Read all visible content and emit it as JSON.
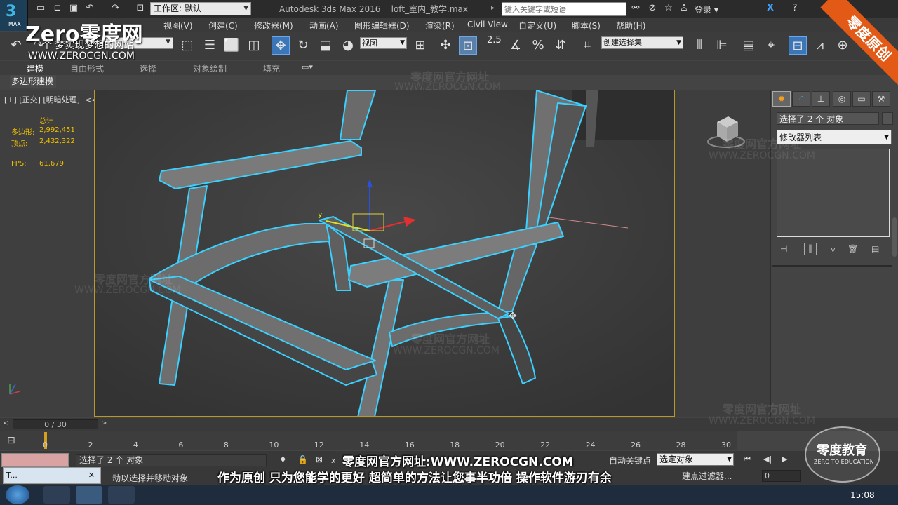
{
  "titlebar": {
    "workspace_label": "工作区: 默认",
    "app_title": "Autodesk 3ds Max 2016",
    "file_name": "loft_室内_教学.max",
    "search_placeholder": "键入关键字或短语",
    "login_label": "登录"
  },
  "menu": [
    {
      "label": "视图(V)"
    },
    {
      "label": "创建(C)"
    },
    {
      "label": "修改器(M)"
    },
    {
      "label": "动画(A)"
    },
    {
      "label": "图形编辑器(D)"
    },
    {
      "label": "渲染(R)"
    },
    {
      "label": "Civil View"
    },
    {
      "label": "自定义(U)"
    },
    {
      "label": "脚本(S)"
    },
    {
      "label": "帮助(H)"
    }
  ],
  "toolbar": {
    "view_dropdown": "视图",
    "selection_set": "创建选择集",
    "snap_value": "2.5"
  },
  "ribbon": {
    "tabs": [
      {
        "label": "建模"
      },
      {
        "label": "自由形式"
      },
      {
        "label": "选择"
      },
      {
        "label": "对象绘制"
      },
      {
        "label": "填充"
      }
    ],
    "sub_label": "多边形建模"
  },
  "viewport": {
    "label": "[+] [正交] [明暗处理]",
    "disabled_label": "<<已禁用>>",
    "stats": {
      "total_label": "总计",
      "poly_label": "多边形:",
      "poly_value": "2,992,451",
      "vert_label": "顶点:",
      "vert_value": "2,432,322",
      "fps_label": "FPS:",
      "fps_value": "61.679"
    },
    "gizmo_y_label": "y"
  },
  "command_panel": {
    "object_name": "选择了 2 个 对象",
    "modifier_list": "修改器列表"
  },
  "timeline": {
    "frame_label": "0 / 30",
    "ticks": [
      "0",
      "2",
      "4",
      "6",
      "8",
      "10",
      "12",
      "14",
      "16",
      "18",
      "20",
      "22",
      "24",
      "26",
      "28",
      "30"
    ]
  },
  "status": {
    "selection_msg": "选择了 2 个 对象",
    "prompt": "动以选择并移动对象",
    "autokey_label": "自动关键点",
    "selected_dropdown": "选定对象",
    "key_filter": "建点过滤器...",
    "frame_value": "0"
  },
  "watermarks": {
    "logo": "Zero零度网",
    "slogan": "个 梦实现梦想的网站",
    "url": "WWW.ZEROCGN.COM",
    "ghost_cn": "零度网官方网址",
    "ghost_url": "WWW.ZEROCGN.COM",
    "subtitle_line1": "零度网官方网址:WWW.ZEROCGN.COM",
    "subtitle_line2": "作为原创 只为您能学的更好 超简单的方法让您事半功倍 操作软件游刃有余",
    "corner_label": "零度原创",
    "corner_url": "WWW.ZEROCGN.COM",
    "edu_title": "零度教育",
    "edu_sub": "ZERO TO EDUCATION"
  },
  "taskbar": {
    "clock": "15:08",
    "task_label": "T..."
  },
  "colors": {
    "selection_highlight": "#3ad0ff",
    "viewport_border": "#b59a2a",
    "active_tool": "#3b76b9",
    "corner_ribbon": "#e25a16"
  }
}
